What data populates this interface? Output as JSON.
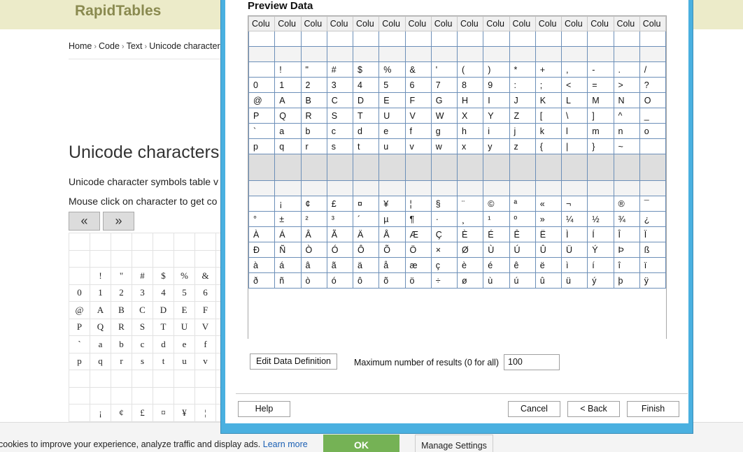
{
  "site": {
    "logo": "RapidTables",
    "breadcrumb": [
      "Home",
      "Code",
      "Text",
      "Unicode character"
    ],
    "breadcrumb_sep": "›",
    "heading": "Unicode characters",
    "intro": "Unicode character symbols table v",
    "instruction": "Mouse click on character to get co",
    "prev_label": "«",
    "next_label": "»",
    "grid": [
      [
        "",
        "",
        "",
        "",
        "",
        "",
        "",
        ""
      ],
      [
        "",
        "",
        "",
        "",
        "",
        "",
        "",
        ""
      ],
      [
        "",
        "!",
        "\"",
        "#",
        "$",
        "%",
        "&",
        ""
      ],
      [
        "0",
        "1",
        "2",
        "3",
        "4",
        "5",
        "6",
        ""
      ],
      [
        "@",
        "A",
        "B",
        "C",
        "D",
        "E",
        "F",
        ""
      ],
      [
        "P",
        "Q",
        "R",
        "S",
        "T",
        "U",
        "V",
        ""
      ],
      [
        "`",
        "a",
        "b",
        "c",
        "d",
        "e",
        "f",
        ""
      ],
      [
        "p",
        "q",
        "r",
        "s",
        "t",
        "u",
        "v",
        ""
      ],
      [
        "",
        "",
        "",
        "",
        "",
        "",
        "",
        ""
      ],
      [
        "",
        "",
        "",
        "",
        "",
        "",
        "",
        ""
      ],
      [
        "",
        "¡",
        "¢",
        "£",
        "¤",
        "¥",
        "¦",
        ""
      ]
    ]
  },
  "cookie": {
    "text": "cookies to improve your experience, analyze traffic and display ads.",
    "link": "Learn more",
    "ok": "OK",
    "manage": "Manage Settings"
  },
  "dialog": {
    "title": "Preview Data",
    "column_header": "Colu",
    "column_count": 16,
    "rows": [
      [
        "",
        "",
        "",
        "",
        "",
        "",
        "",
        "",
        "",
        "",
        "",
        "",
        "",
        "",
        "",
        ""
      ],
      [
        "",
        "",
        "",
        "",
        "",
        "",
        "",
        "",
        "",
        "",
        "",
        "",
        "",
        "",
        "",
        ""
      ],
      [
        "",
        "!",
        "\"",
        "#",
        "$",
        "%",
        "&",
        "'",
        "(",
        ")",
        "*",
        "+",
        ",",
        "-",
        ".",
        "/"
      ],
      [
        "0",
        "1",
        "2",
        "3",
        "4",
        "5",
        "6",
        "7",
        "8",
        "9",
        ":",
        ";",
        "<",
        "=",
        ">",
        "?"
      ],
      [
        "@",
        "A",
        "B",
        "C",
        "D",
        "E",
        "F",
        "G",
        "H",
        "I",
        "J",
        "K",
        "L",
        "M",
        "N",
        "O"
      ],
      [
        "P",
        "Q",
        "R",
        "S",
        "T",
        "U",
        "V",
        "W",
        "X",
        "Y",
        "Z",
        "[",
        "\\",
        "]",
        "^",
        "_"
      ],
      [
        "`",
        "a",
        "b",
        "c",
        "d",
        "e",
        "f",
        "g",
        "h",
        "i",
        "j",
        "k",
        "l",
        "m",
        "n",
        "o"
      ],
      [
        "p",
        "q",
        "r",
        "s",
        "t",
        "u",
        "v",
        "w",
        "x",
        "y",
        "z",
        "{",
        "|",
        "}",
        "~",
        ""
      ],
      [
        "",
        "",
        "",
        "",
        "",
        "",
        "",
        "",
        "",
        "",
        "",
        "",
        "",
        "",
        "",
        ""
      ],
      [
        "",
        "",
        "",
        "",
        "",
        "",
        "",
        "",
        "",
        "",
        "",
        "",
        "",
        "",
        "",
        ""
      ],
      [
        "",
        "¡",
        "¢",
        "£",
        "¤",
        "¥",
        "¦",
        "§",
        "¨",
        "©",
        "ª",
        "«",
        "¬",
        "",
        "®",
        "¯"
      ],
      [
        "°",
        "±",
        "²",
        "³",
        "´",
        "µ",
        "¶",
        "·",
        "¸",
        "¹",
        "º",
        "»",
        "¼",
        "½",
        "¾",
        "¿"
      ],
      [
        "À",
        "Á",
        "Â",
        "Ã",
        "Ä",
        "Å",
        "Æ",
        "Ç",
        "È",
        "É",
        "Ê",
        "Ë",
        "Ì",
        "Í",
        "Î",
        "Ï"
      ],
      [
        "Ð",
        "Ñ",
        "Ò",
        "Ó",
        "Ô",
        "Õ",
        "Ö",
        "×",
        "Ø",
        "Ù",
        "Ú",
        "Û",
        "Ü",
        "Ý",
        "Þ",
        "ß"
      ],
      [
        "à",
        "á",
        "â",
        "ã",
        "ä",
        "å",
        "æ",
        "ç",
        "è",
        "é",
        "ê",
        "ë",
        "ì",
        "í",
        "î",
        "ï"
      ],
      [
        "ð",
        "ñ",
        "ò",
        "ó",
        "ô",
        "õ",
        "ö",
        "÷",
        "ø",
        "ù",
        "ú",
        "û",
        "ü",
        "ý",
        "þ",
        "ÿ"
      ]
    ],
    "edit_button": "Edit Data Definition",
    "max_label": "Maximum number of results (0 for all)",
    "max_value": "100",
    "help_button": "Help",
    "cancel_button": "Cancel",
    "back_button": "< Back",
    "finish_button": "Finish"
  }
}
